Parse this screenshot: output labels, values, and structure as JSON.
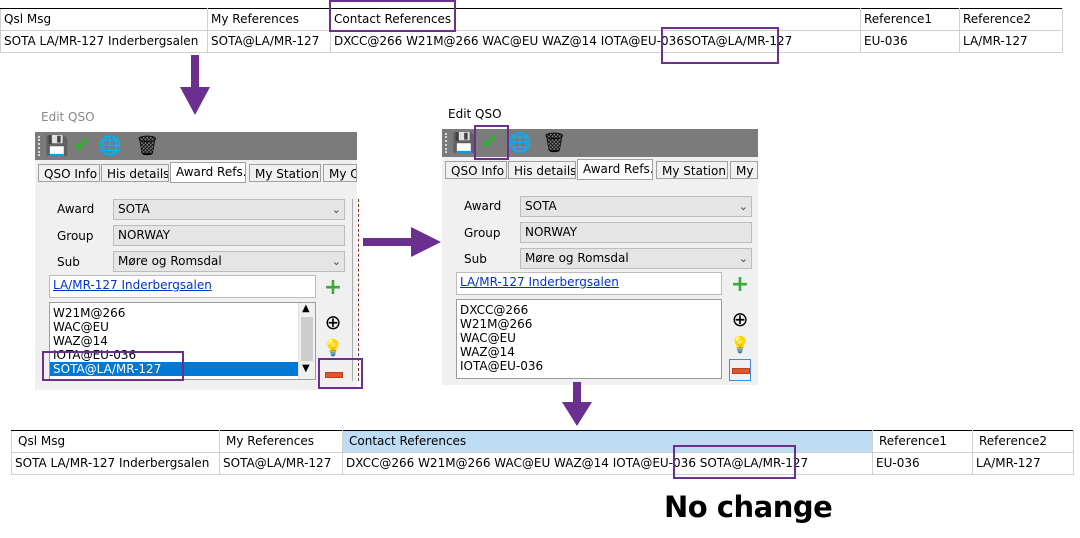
{
  "top_grid": {
    "headers": [
      "Qsl Msg",
      "My References",
      "Contact References",
      "Reference1",
      "Reference2"
    ],
    "row": [
      "SOTA LA/MR-127 Inderbergsalen",
      "SOTA@LA/MR-127",
      "DXCC@266 W21M@266 WAC@EU WAZ@14 IOTA@EU-036",
      "SOTA@LA/MR-127",
      "EU-036",
      "LA/MR-127"
    ]
  },
  "dialog_left": {
    "caption": "Edit QSO",
    "tabs": [
      "QSO Info",
      "His details",
      "Award Refs.",
      "My Station",
      "My Q"
    ],
    "award_label": "Award",
    "award_value": "SOTA",
    "group_label": "Group",
    "group_value": "NORWAY",
    "sub_label": "Sub",
    "sub_value": "Møre og Romsdal",
    "link": "LA/MR-127 Inderbergsalen",
    "list": [
      "W21M@266",
      "WAC@EU",
      "WAZ@14",
      "IOTA@EU-036",
      "SOTA@LA/MR-127"
    ]
  },
  "dialog_right": {
    "caption": "Edit QSO",
    "tabs": [
      "QSO Info",
      "His details",
      "Award Refs.",
      "My Station",
      "My Q"
    ],
    "award_label": "Award",
    "award_value": "SOTA",
    "group_label": "Group",
    "group_value": "NORWAY",
    "sub_label": "Sub",
    "sub_value": "Møre og Romsdal",
    "link": "LA/MR-127 Inderbergsalen",
    "list": [
      "DXCC@266",
      "W21M@266",
      "WAC@EU",
      "WAZ@14",
      "IOTA@EU-036"
    ]
  },
  "bottom_grid": {
    "headers": [
      "Qsl Msg",
      "My References",
      "Contact References",
      "Reference1",
      "Reference2"
    ],
    "row": [
      "SOTA LA/MR-127 Inderbergsalen",
      "SOTA@LA/MR-127",
      "DXCC@266 W21M@266 WAC@EU WAZ@14 IOTA@EU-036",
      "SOTA@LA/MR-127",
      "EU-036",
      "LA/MR-127"
    ]
  },
  "annotation": "No change",
  "colors": {
    "highlight": "#6a2f8f",
    "arrow": "#6a2f8f",
    "selected_header": "#bedcf3",
    "selection": "#0078d7",
    "toolbar": "#7b7b7b"
  }
}
